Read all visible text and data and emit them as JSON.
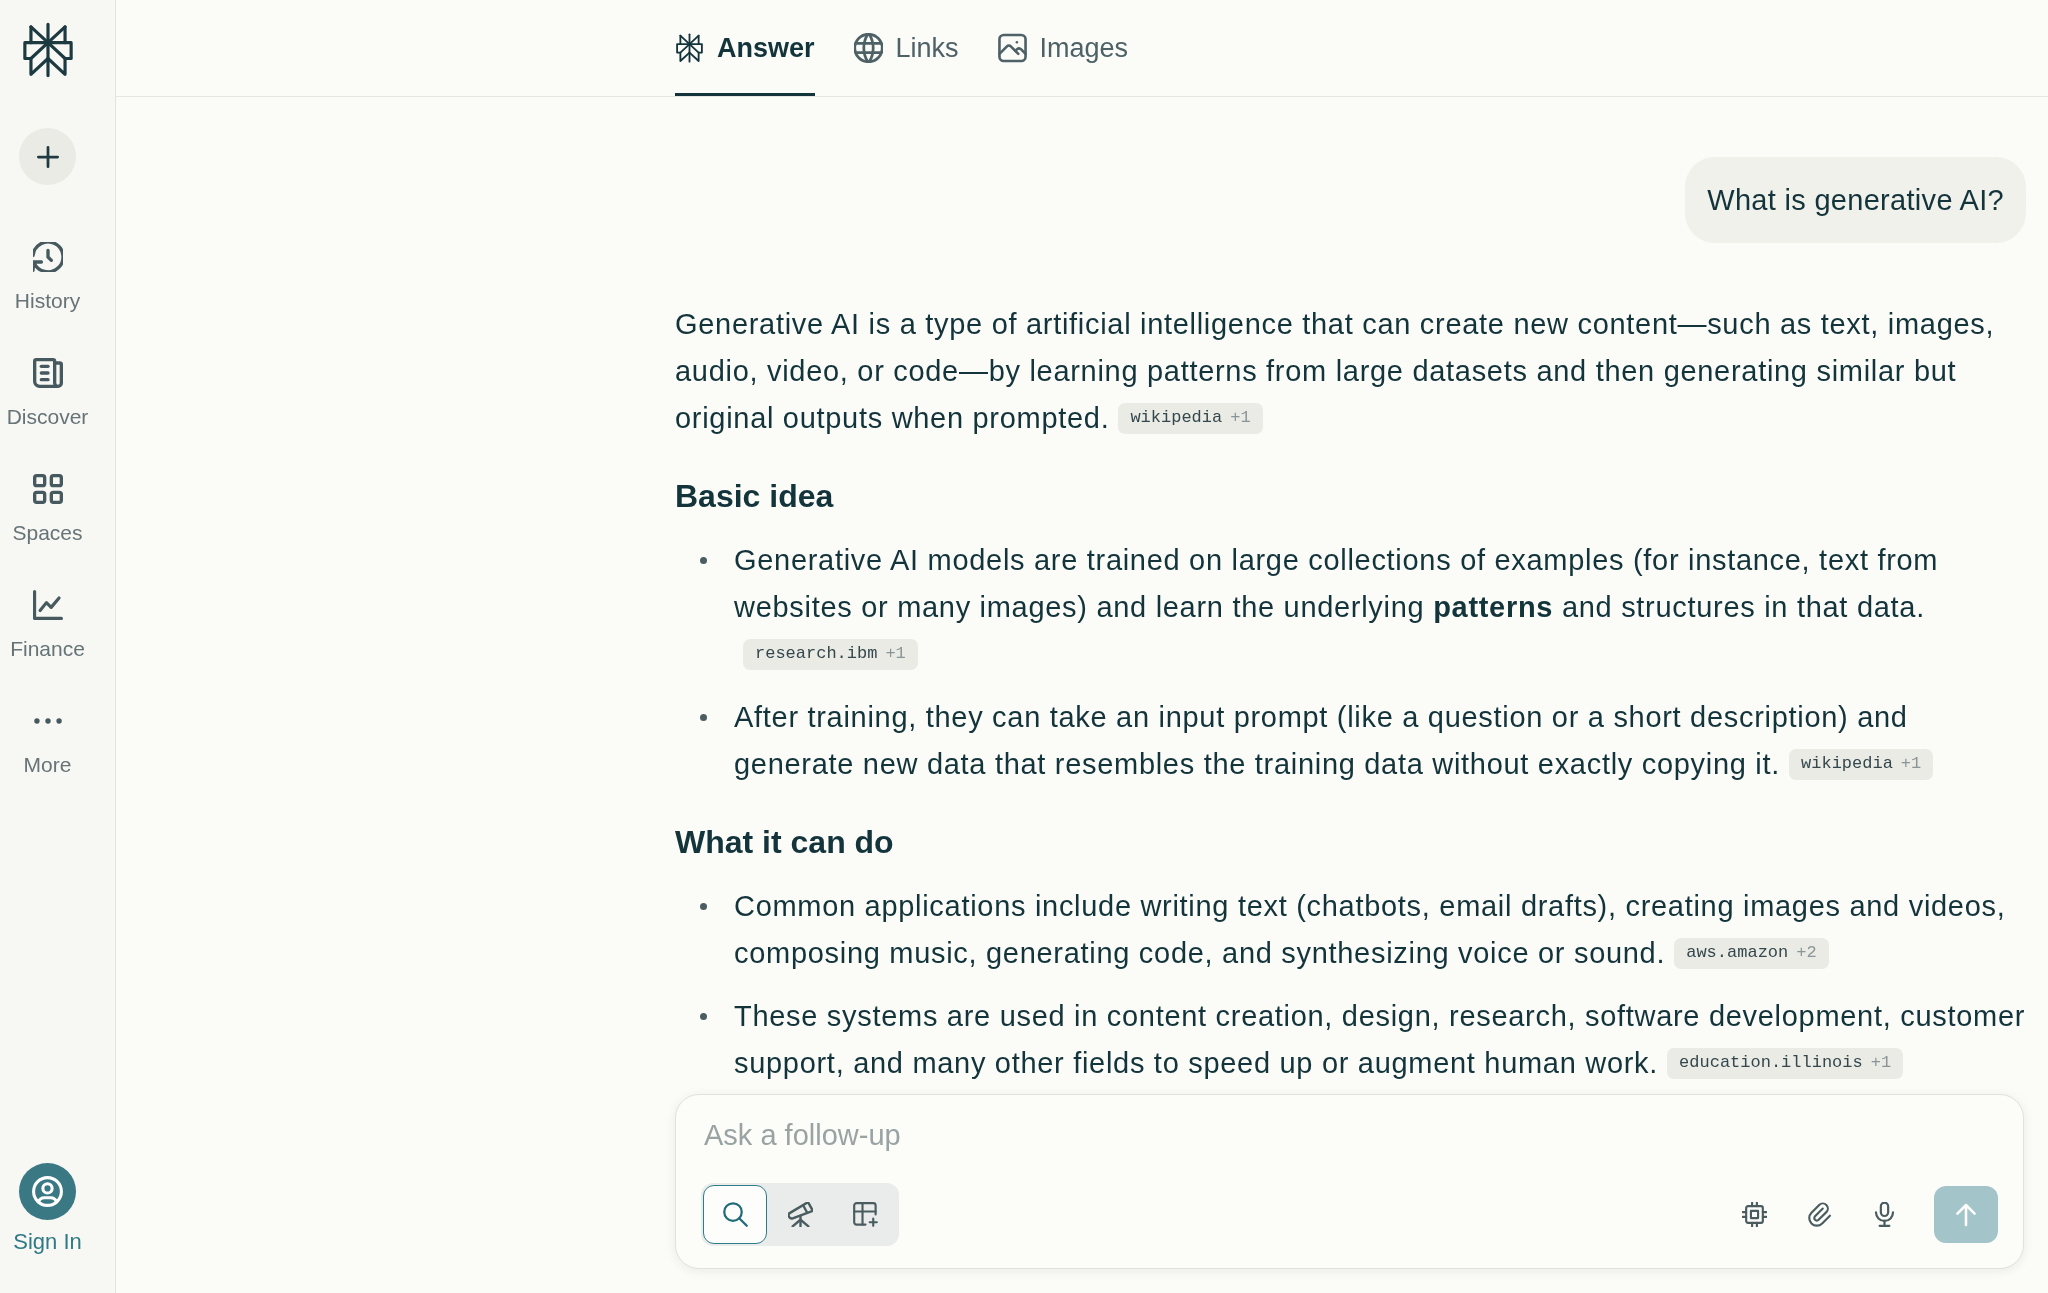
{
  "sidebar": {
    "items": [
      {
        "label": "History",
        "selected": false
      },
      {
        "label": "Discover",
        "selected": false
      },
      {
        "label": "Spaces",
        "selected": false
      },
      {
        "label": "Finance",
        "selected": false
      },
      {
        "label": "More",
        "selected": false
      }
    ],
    "sign_in": {
      "label": "Sign In"
    }
  },
  "tabs": [
    {
      "label": "Answer",
      "selected": true
    },
    {
      "label": "Links",
      "selected": false
    },
    {
      "label": "Images",
      "selected": false
    }
  ],
  "question": "What is generative AI?",
  "answer": [
    {
      "kind": "paragraph",
      "text": "Generative AI is a type of artificial intelligence that can create new content—such as text, images, audio, video, or code—by learning patterns from large datasets and then generating similar but original outputs when prompted.",
      "citation": {
        "source": "wikipedia",
        "extra": "+1"
      }
    },
    {
      "kind": "heading",
      "text": "Basic idea"
    },
    {
      "kind": "list",
      "items": [
        {
          "text": "Generative AI models are trained on large collections of examples (for instance, text from websites or many images) and learn the underlying **patterns** and structures in that data.",
          "citation": {
            "source": "research.ibm",
            "extra": "+1"
          }
        },
        {
          "text": "After training, they can take an input prompt (like a question or a short description) and generate new data that resembles the training data without exactly copying it.",
          "citation": {
            "source": "wikipedia",
            "extra": "+1"
          }
        }
      ]
    },
    {
      "kind": "heading",
      "text": "What it can do"
    },
    {
      "kind": "list",
      "items": [
        {
          "text": "Common applications include writing text (chatbots, email drafts), creating images and videos, composing music, generating code, and synthesizing voice or sound.",
          "citation": {
            "source": "aws.amazon",
            "extra": "+2"
          }
        },
        {
          "text": "These systems are used in content creation, design, research, software development, customer support, and many other fields to speed up or augment human work.",
          "citation": {
            "source": "education.illinois",
            "extra": "+1"
          }
        }
      ]
    }
  ],
  "composer": {
    "placeholder": "Ask a follow-up",
    "modes": [
      {
        "selected": true
      },
      {
        "selected": false
      },
      {
        "selected": false
      }
    ],
    "send_disabled": true
  }
}
